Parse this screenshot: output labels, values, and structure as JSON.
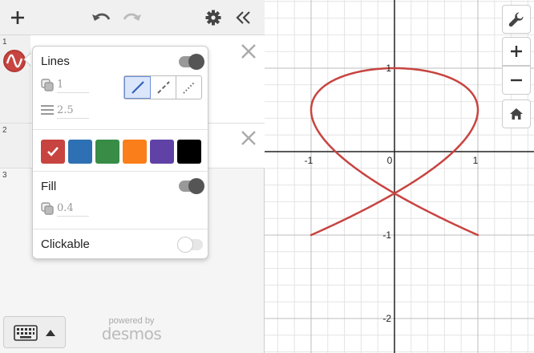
{
  "expressions": [
    {
      "index": "1"
    },
    {
      "index": "2"
    },
    {
      "index": "3"
    }
  ],
  "style_popup": {
    "lines_label": "Lines",
    "lines_opacity_value": "1",
    "lines_width_value": "2.5",
    "fill_label": "Fill",
    "fill_opacity_value": "0.4",
    "clickable_label": "Clickable",
    "lines_enabled": true,
    "fill_enabled": true,
    "clickable_enabled": false,
    "line_styles": [
      "solid",
      "dashed",
      "dotted"
    ],
    "selected_line_style": "solid",
    "colors": [
      "#c74440",
      "#2d70b3",
      "#388c46",
      "#fa7e19",
      "#6042a6",
      "#000000"
    ],
    "selected_color": "#c74440"
  },
  "branding": {
    "powered_by": "powered by",
    "name": "desmos"
  },
  "graph": {
    "x_ticks": [
      {
        "value": -1,
        "label": "-1"
      },
      {
        "value": 0,
        "label": "0"
      },
      {
        "value": 1,
        "label": "1"
      }
    ],
    "y_ticks": [
      {
        "value": 1,
        "label": "1"
      },
      {
        "value": -1,
        "label": "-1"
      },
      {
        "value": -2,
        "label": "-2"
      }
    ],
    "curve_color": "#c74440",
    "fill_opacity": 0.4
  }
}
